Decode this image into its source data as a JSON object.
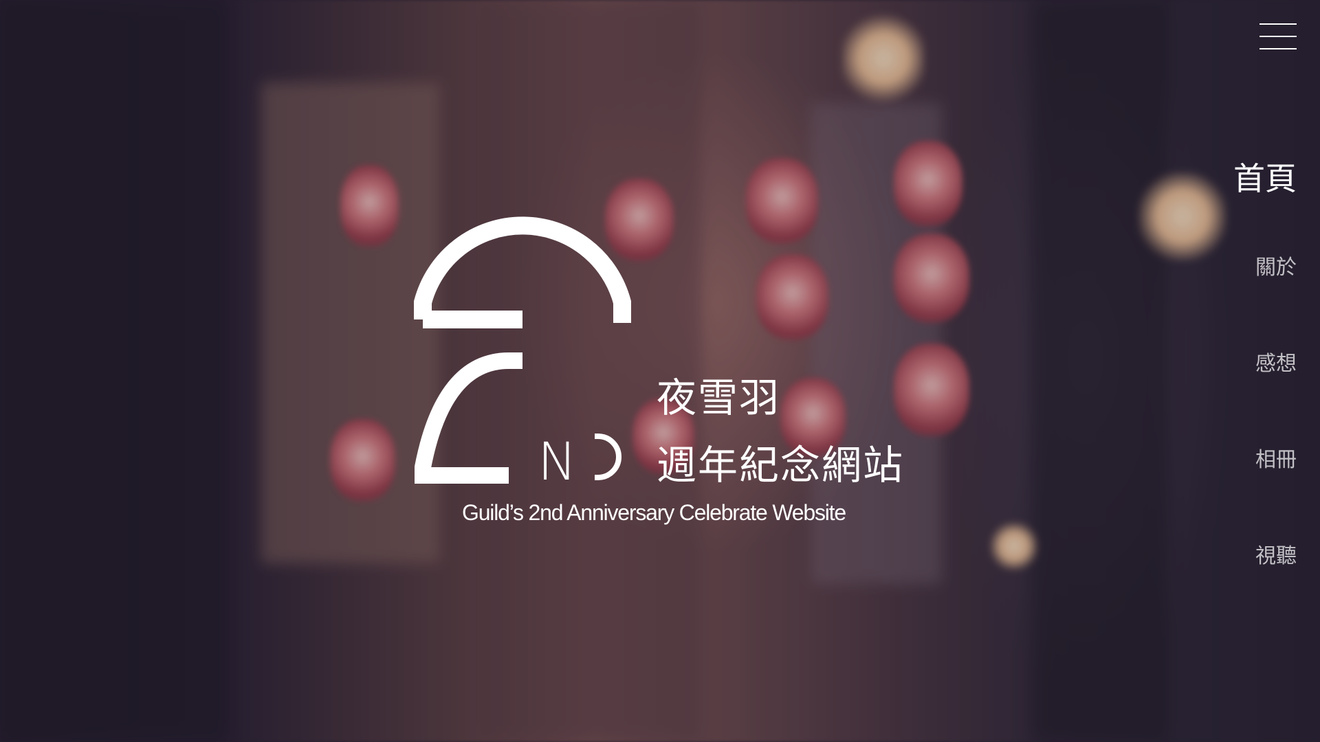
{
  "hero": {
    "logo_letters": "ND",
    "title_line1": "夜雪羽",
    "title_line2": "週年紀念網站",
    "subtitle": "Guild’s 2nd Anniversary Celebrate Website"
  },
  "menu": {
    "icon": "hamburger-menu-icon"
  },
  "nav": {
    "items": [
      {
        "label": "首頁",
        "active": true
      },
      {
        "label": "關於",
        "active": false
      },
      {
        "label": "感想",
        "active": false
      },
      {
        "label": "相冊",
        "active": false
      },
      {
        "label": "視聽",
        "active": false
      }
    ]
  },
  "colors": {
    "text": "#ffffff",
    "background_dark": "#231d2d",
    "lantern": "#d87a7f"
  }
}
